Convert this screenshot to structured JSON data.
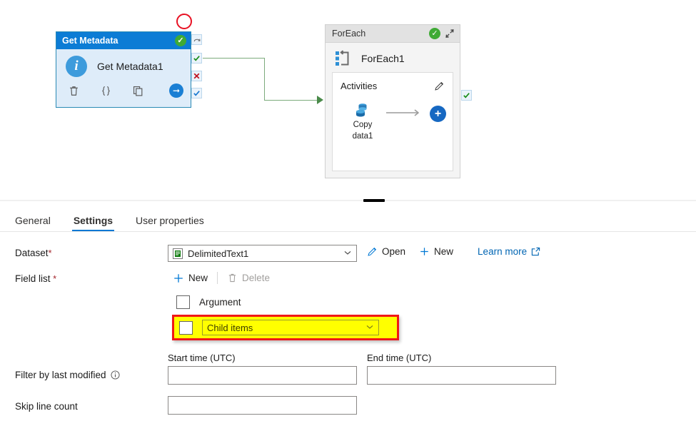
{
  "canvas": {
    "annotation_circle": {
      "name": "red-circle-annotation",
      "color": "#e81123"
    },
    "get_metadata": {
      "header_title": "Get Metadata",
      "status_icon": "green-check-icon",
      "activity_name": "Get Metadata1",
      "type_icon": "info-circle-icon",
      "actions": [
        "delete-icon",
        "code-braces-icon",
        "clone-icon"
      ],
      "run_icon": "arrow-right-circle-icon",
      "header_color": "#0c7cd5",
      "body_color": "#deecf9"
    },
    "connector_stubs": [
      {
        "name": "on-skip-stub",
        "icon": "curved-arrow-icon"
      },
      {
        "name": "on-success-stub",
        "icon": "green-check-icon"
      },
      {
        "name": "on-failure-stub",
        "icon": "red-x-icon"
      },
      {
        "name": "on-completion-stub",
        "icon": "blue-check-icon"
      }
    ],
    "connector_line_color": "#7cab7c",
    "foreach": {
      "header_title": "ForEach",
      "status_icon": "green-check-icon",
      "collapse_icon": "collapse-icon",
      "activity_name": "ForEach1",
      "type_icon": "loop-icon",
      "activities_label": "Activities",
      "edit_icon": "pencil-icon",
      "inner_activity": {
        "label_line1": "Copy",
        "label_line2": "data1",
        "icon": "copy-data-icon"
      },
      "add_icon": "plus-circle-icon",
      "header_color": "#e2e2e2"
    },
    "foreach_success_stub": {
      "name": "foreach-on-success-stub",
      "icon": "green-check-icon"
    }
  },
  "splitter": {
    "grip_name": "panel-resize-grip"
  },
  "tabs": [
    {
      "id": "general",
      "label": "General",
      "active": false
    },
    {
      "id": "settings",
      "label": "Settings",
      "active": true
    },
    {
      "id": "user-properties",
      "label": "User properties",
      "active": false
    }
  ],
  "accent_color": "#0078d4",
  "form": {
    "dataset": {
      "label": "Dataset",
      "required_mark": "*",
      "value": "DelimitedText1",
      "icon": "dataset-document-icon",
      "chevron": "chevron-down-icon",
      "open_label": "Open",
      "open_icon": "pencil-icon",
      "new_label": "New",
      "new_icon": "plus-icon",
      "learn_more_label": "Learn more",
      "learn_more_icon": "external-link-icon"
    },
    "field_list": {
      "label": "Field list",
      "required_mark": "*",
      "new_label": "New",
      "new_icon": "plus-icon",
      "delete_label": "Delete",
      "delete_icon": "trash-icon",
      "delete_disabled": true,
      "items": [
        {
          "name": "argument-row",
          "checkbox_checked": false,
          "text": "Argument",
          "highlighted": false
        },
        {
          "name": "child-items-row",
          "checkbox_checked": false,
          "text": "Child items",
          "chevron": "chevron-down-icon",
          "highlighted": true
        }
      ],
      "highlight_fill": "#ffff00",
      "highlight_border": "#f01717"
    },
    "filter_by_last_modified": {
      "label": "Filter by last modified",
      "info_icon": "info-icon",
      "start_time_label": "Start time (UTC)",
      "start_time_value": "",
      "end_time_label": "End time (UTC)",
      "end_time_value": ""
    },
    "skip_line_count": {
      "label": "Skip line count",
      "value": ""
    }
  }
}
